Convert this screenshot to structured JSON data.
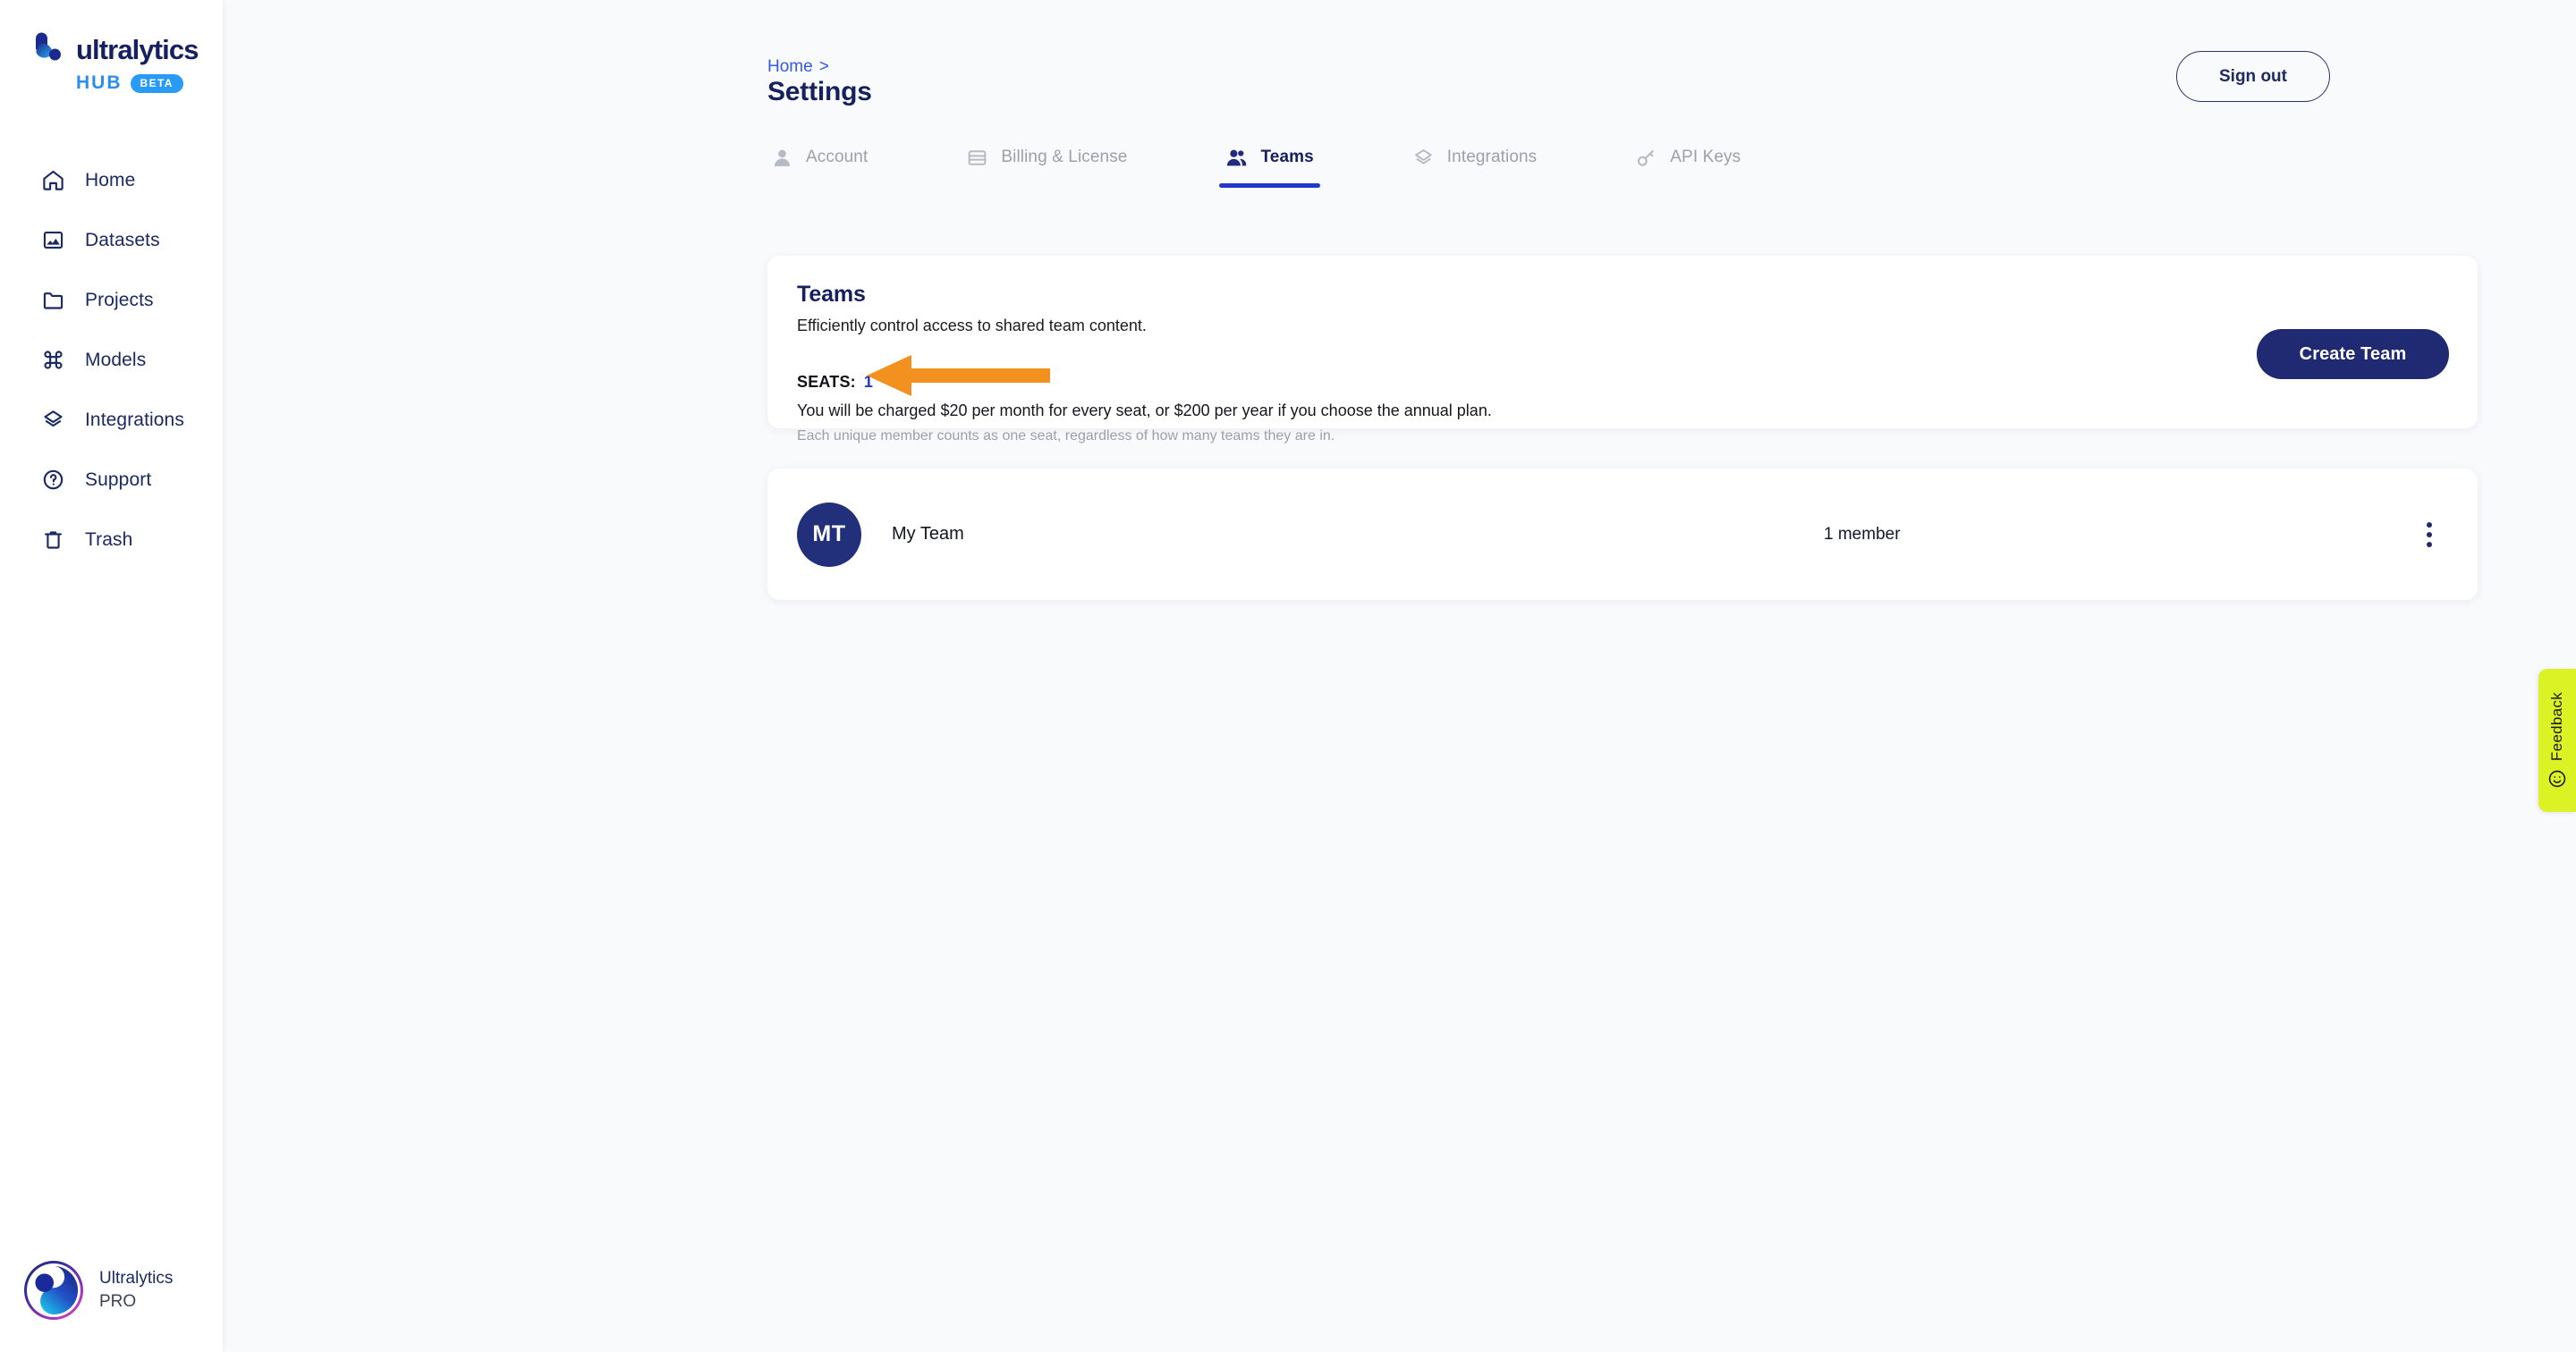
{
  "brand": {
    "word": "ultralytics",
    "hub": "HUB",
    "beta": "BETA",
    "logo_icon": "ultralytics-logo-icon"
  },
  "sidebar": {
    "items": [
      {
        "label": "Home",
        "icon": "home-icon"
      },
      {
        "label": "Datasets",
        "icon": "image-icon"
      },
      {
        "label": "Projects",
        "icon": "folder-icon"
      },
      {
        "label": "Models",
        "icon": "command-icon"
      },
      {
        "label": "Integrations",
        "icon": "layers-icon"
      },
      {
        "label": "Support",
        "icon": "question-circle-icon"
      },
      {
        "label": "Trash",
        "icon": "trash-icon"
      }
    ],
    "profile": {
      "name": "Ultralytics",
      "plan": "PRO",
      "avatar_icon": "user-avatar-icon"
    }
  },
  "header": {
    "breadcrumb_home": "Home",
    "breadcrumb_separator": ">",
    "title": "Settings",
    "sign_out_label": "Sign out"
  },
  "tabs": [
    {
      "label": "Account",
      "icon": "person-icon",
      "active": false
    },
    {
      "label": "Billing & License",
      "icon": "credit-card-icon",
      "active": false
    },
    {
      "label": "Teams",
      "icon": "people-icon",
      "active": true
    },
    {
      "label": "Integrations",
      "icon": "layers-icon",
      "active": false
    },
    {
      "label": "API Keys",
      "icon": "key-icon",
      "active": false
    }
  ],
  "teams_card": {
    "heading": "Teams",
    "subheading": "Efficiently control access to shared team content.",
    "seats_label": "SEATS:",
    "seats_value": "1",
    "charge_line": "You will be charged $20 per month for every seat, or $200 per year if you choose the annual plan.",
    "charge_note": "Each unique member counts as one seat, regardless of how many teams they are in.",
    "create_team_label": "Create Team"
  },
  "team_row": {
    "avatar_initials": "MT",
    "name": "My Team",
    "members": "1 member",
    "menu_icon": "kebab-menu-icon"
  },
  "annotation": {
    "type": "arrow",
    "direction": "left",
    "color": "#f29020",
    "points_to": "seats_value"
  },
  "feedback": {
    "label": "Feedback",
    "icon": "smiley-face-icon",
    "color": "#dbf224"
  },
  "colors": {
    "navy": "#16205e",
    "accent_blue": "#2138c9",
    "link_blue": "#3558e8",
    "muted": "#9ba0ab",
    "page_bg": "#f9fafc",
    "button_navy": "#1f2a72",
    "annotation_orange": "#f29020",
    "feedback_green": "#dbf224"
  }
}
